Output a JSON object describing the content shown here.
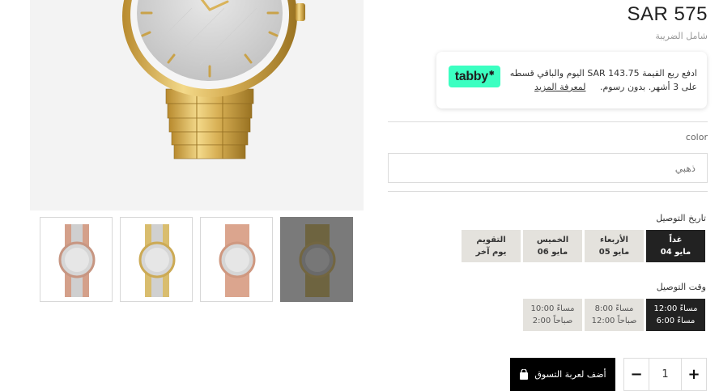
{
  "product": {
    "price": "SAR 575",
    "tax_note": "شامل الضريبة",
    "thumbnails": [
      {
        "variant": "rose-silver"
      },
      {
        "variant": "gold-silver"
      },
      {
        "variant": "rose-gold"
      },
      {
        "variant": "gold",
        "selected": true
      }
    ]
  },
  "tabby": {
    "logo": "tabby",
    "text": "ادفع ربع القيمة SAR 143.75 اليوم والباقي قسطه على 3 أشهر. بدون رسوم.",
    "learn_more": "لمعرفة المزيد",
    "brand_color": "#3bffc1"
  },
  "color": {
    "label": "color",
    "value": "ذهبي"
  },
  "delivery_date": {
    "title": "تاريخ التوصيل",
    "options": [
      {
        "line1": "غداً",
        "line2": "04 مايو",
        "selected": true
      },
      {
        "line1": "الأربعاء",
        "line2": "05 مايو",
        "selected": false
      },
      {
        "line1": "الخميس",
        "line2": "06 مايو",
        "selected": false
      },
      {
        "line1": "التقويم",
        "line2": "يوم آخر",
        "selected": false
      }
    ]
  },
  "delivery_time": {
    "title": "وقت التوصيل",
    "options": [
      {
        "line1": "12:00 مساءً",
        "line2": "6:00 مساءً",
        "selected": true
      },
      {
        "line1": "8:00 مساءً",
        "line2": "12:00 صباحاً",
        "selected": false
      },
      {
        "line1": "10:00 مساءً",
        "line2": "2:00 صباحاً",
        "selected": false
      }
    ]
  },
  "cart": {
    "add_label": "أضف لعربة التسوق",
    "quantity": "1",
    "minus_label": "−",
    "plus_label": "+"
  }
}
